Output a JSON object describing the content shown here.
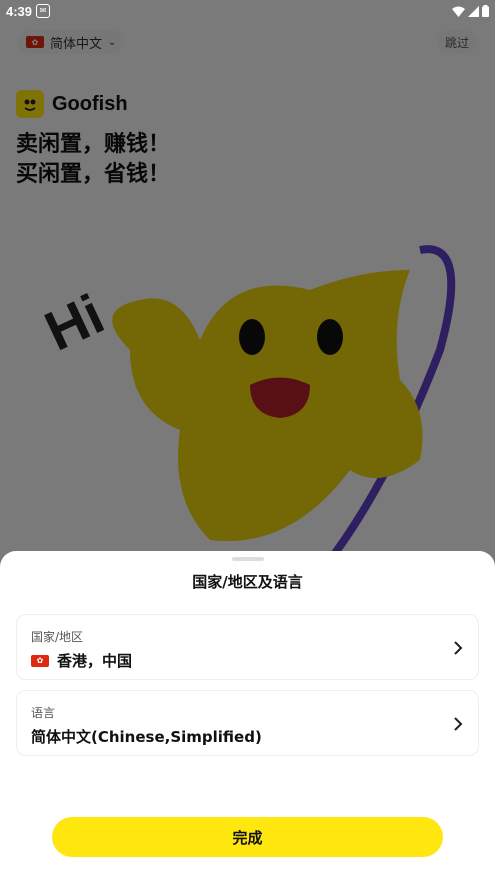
{
  "status_bar": {
    "time": "4:39"
  },
  "background": {
    "language_pill": "简体中文",
    "skip_label": "跳过",
    "brand_name": "Goofish",
    "slogan_line1": "卖闲置，赚钱！",
    "slogan_line2": "买闲置，省钱！",
    "illustration_text": "Hi"
  },
  "sheet": {
    "title": "国家/地区及语言",
    "region": {
      "label": "国家/地区",
      "value": "香港，中国"
    },
    "language": {
      "label": "语言",
      "value": "简体中文(Chinese,Simplified)"
    },
    "done_label": "完成"
  },
  "colors": {
    "brand_yellow": "#ffe60f",
    "overlay": "rgba(0,0,0,0.5)",
    "flag_red": "#de2910"
  },
  "icons": [
    "wifi-icon",
    "signal-icon",
    "battery-icon",
    "chevron-right-icon",
    "chevron-down-icon",
    "hk-flag-icon"
  ]
}
